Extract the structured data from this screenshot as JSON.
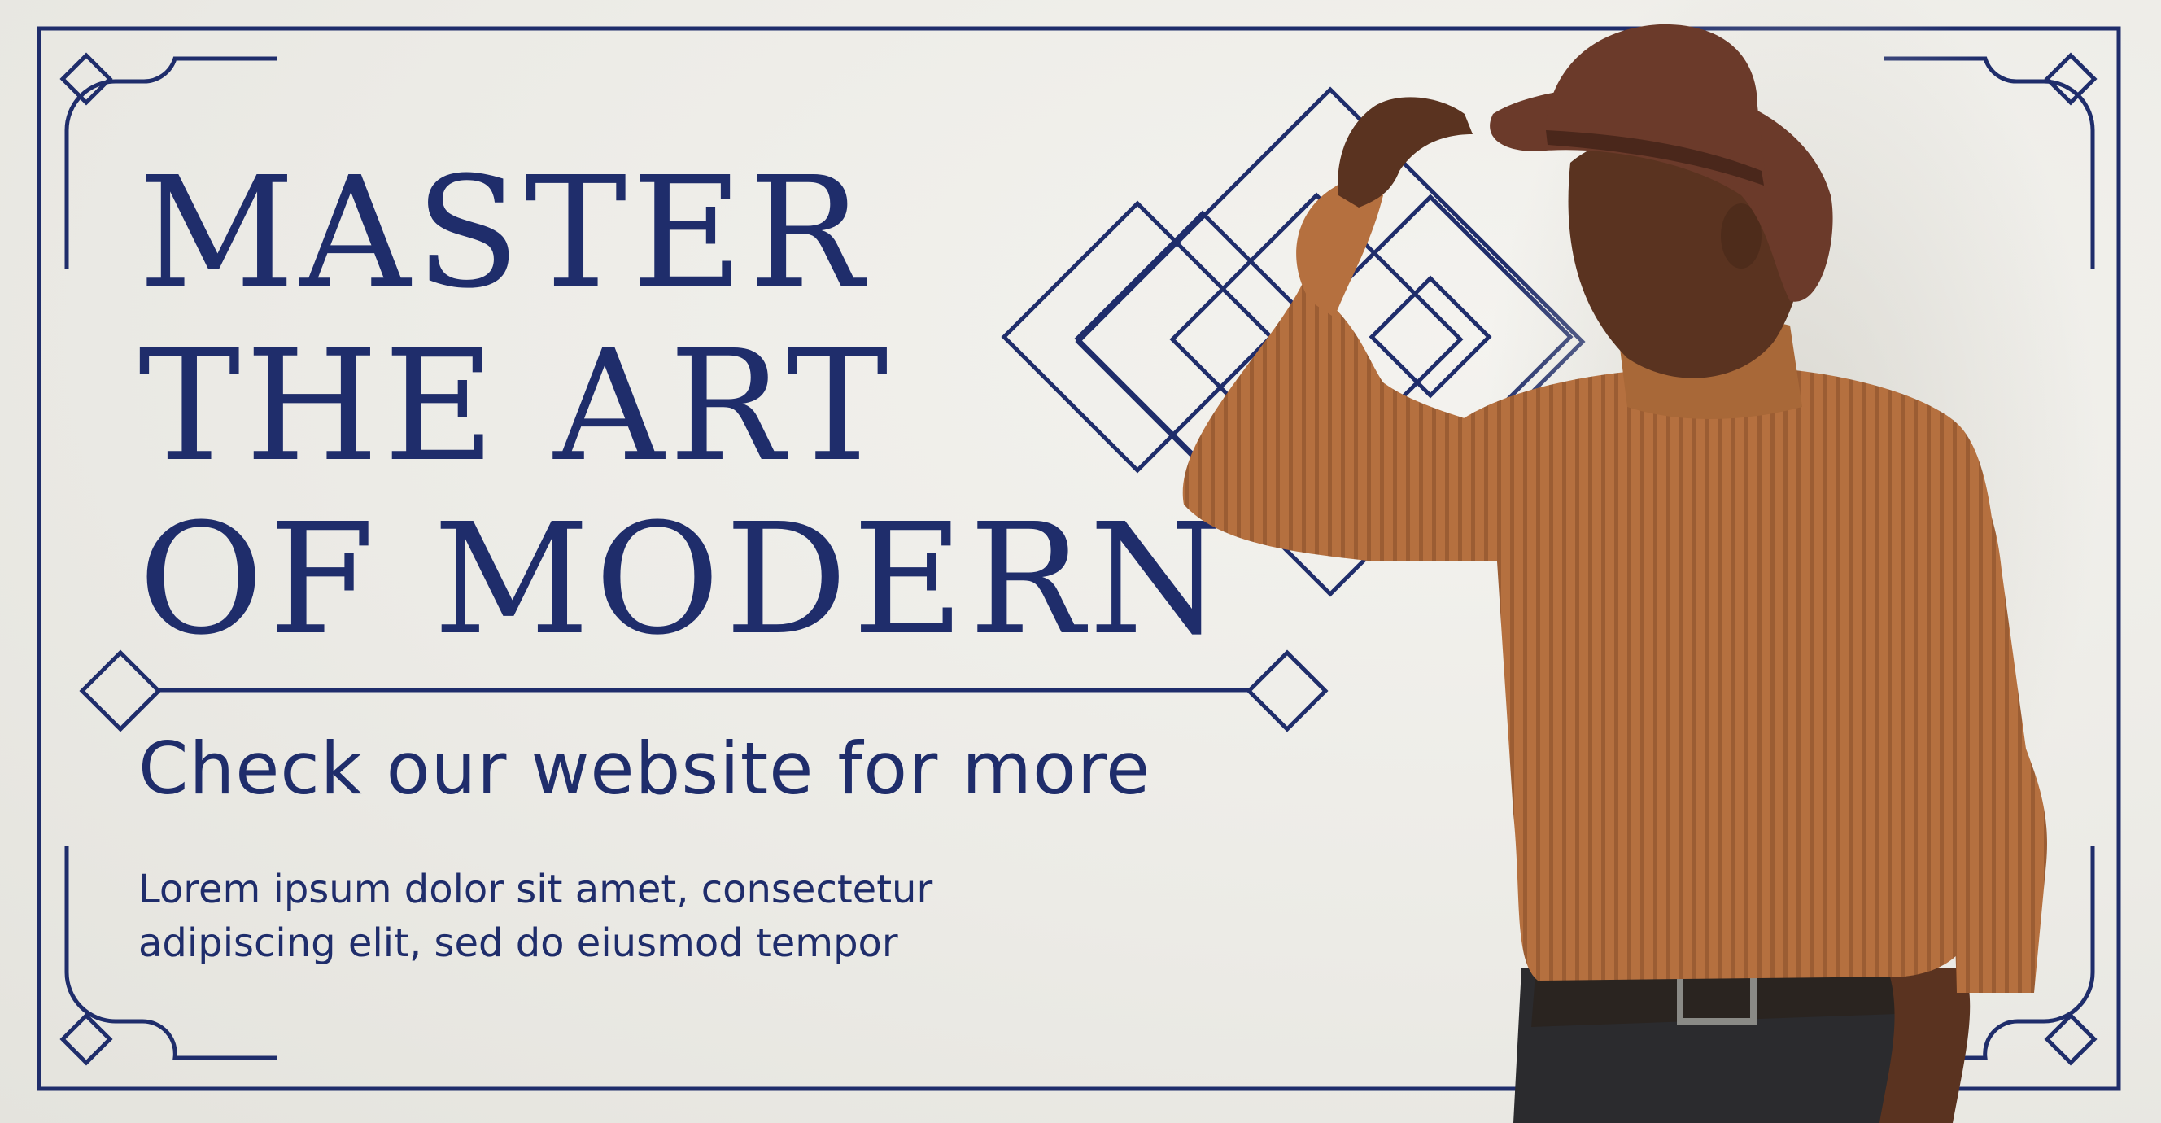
{
  "headline": {
    "line1": "MASTER",
    "line2": "THE ART",
    "line3": "OF MODERN"
  },
  "subhead": "Check our website for more",
  "body": {
    "line1": "Lorem ipsum dolor sit amet, consectetur",
    "line2": "adipiscing elit, sed do eiusmod tempor"
  },
  "colors": {
    "navy": "#1f2d6b",
    "background": "#ecebe6",
    "sweater": "#b5703f",
    "hat": "#6b3a2a"
  },
  "icons": [
    "diamond-ornament-icon",
    "corner-frame-icon"
  ]
}
